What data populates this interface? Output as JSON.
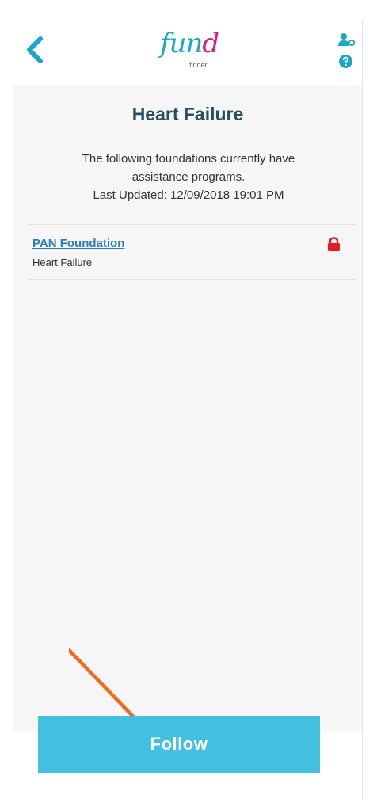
{
  "header": {
    "logo_main_prefix": "fun",
    "logo_main_suffix": "d",
    "logo_sub": "finder",
    "back_icon": "chevron-left-icon",
    "account_icon": "user-settings-icon",
    "help_icon": "help-circle-icon"
  },
  "main": {
    "title": "Heart Failure",
    "description_line1": "The following foundations currently have",
    "description_line2": "assistance programs.",
    "last_updated": "Last Updated: 12/09/2018 19:01 PM"
  },
  "foundations": [
    {
      "name": "PAN Foundation",
      "condition": "Heart Failure",
      "status_icon": "lock-icon",
      "status_color": "#e31c23"
    }
  ],
  "footer": {
    "follow_label": "Follow"
  },
  "colors": {
    "accent": "#43bfdf",
    "brand_blue": "#1aa7c8",
    "brand_pink": "#e0197d",
    "title": "#284f5d",
    "link": "#2a7bc0",
    "annotation_arrow": "#f06a1d"
  }
}
